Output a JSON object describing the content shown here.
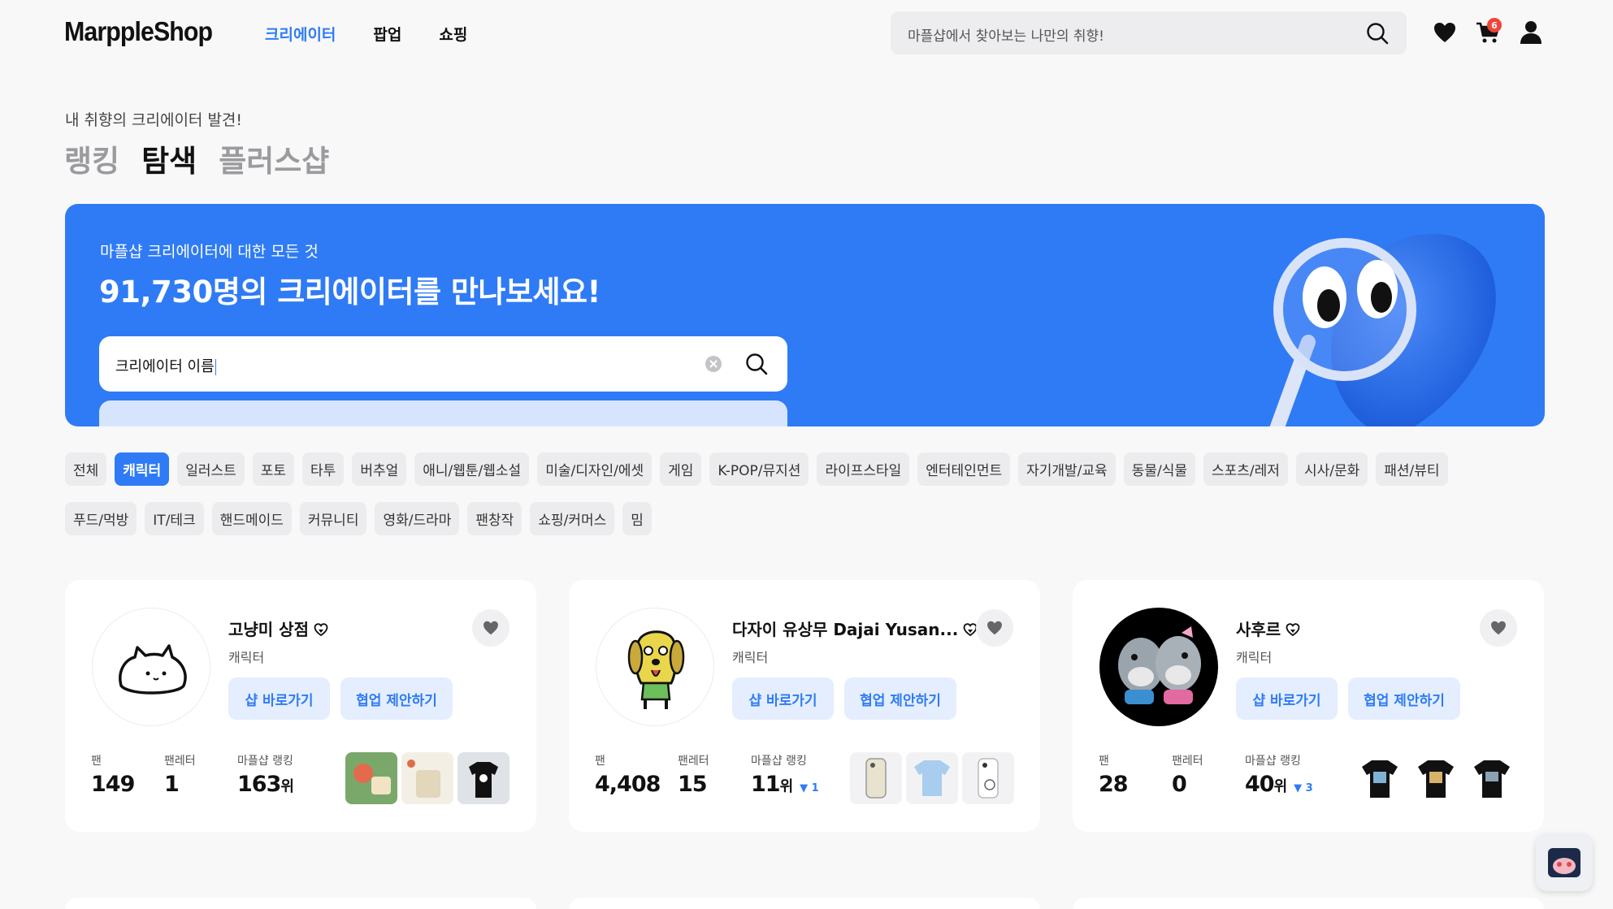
{
  "header": {
    "logo": "MarppleShop",
    "nav": [
      {
        "label": "크리에이터",
        "active": true
      },
      {
        "label": "팝업",
        "active": false
      },
      {
        "label": "쇼핑",
        "active": false
      }
    ],
    "search_placeholder": "마플샵에서 찾아보는 나만의 취향!",
    "cart_count": "6"
  },
  "page": {
    "subtitle": "내 취향의 크리에이터 발견!",
    "tabs": [
      {
        "label": "랭킹",
        "active": false
      },
      {
        "label": "탐색",
        "active": true
      },
      {
        "label": "플러스샵",
        "active": false
      }
    ]
  },
  "banner": {
    "subtitle": "마플샵 크리에이터에 대한 모든 것",
    "title": "91,730명의 크리에이터를 만나보세요!",
    "search_value": "크리에이터 이름"
  },
  "categories": [
    {
      "label": "전체",
      "active": false
    },
    {
      "label": "캐릭터",
      "active": true
    },
    {
      "label": "일러스트",
      "active": false
    },
    {
      "label": "포토",
      "active": false
    },
    {
      "label": "타투",
      "active": false
    },
    {
      "label": "버추얼",
      "active": false
    },
    {
      "label": "애니/웹툰/웹소설",
      "active": false
    },
    {
      "label": "미술/디자인/에셋",
      "active": false
    },
    {
      "label": "게임",
      "active": false
    },
    {
      "label": "K-POP/뮤지션",
      "active": false
    },
    {
      "label": "라이프스타일",
      "active": false
    },
    {
      "label": "엔터테인먼트",
      "active": false
    },
    {
      "label": "자기개발/교육",
      "active": false
    },
    {
      "label": "동물/식물",
      "active": false
    },
    {
      "label": "스포츠/레저",
      "active": false
    },
    {
      "label": "시사/문화",
      "active": false
    },
    {
      "label": "패션/뷰티",
      "active": false
    },
    {
      "label": "푸드/먹방",
      "active": false
    },
    {
      "label": "IT/테크",
      "active": false
    },
    {
      "label": "핸드메이드",
      "active": false
    },
    {
      "label": "커뮤니티",
      "active": false
    },
    {
      "label": "영화/드라마",
      "active": false
    },
    {
      "label": "팬창작",
      "active": false
    },
    {
      "label": "쇼핑/커머스",
      "active": false
    },
    {
      "label": "밈",
      "active": false
    }
  ],
  "card_labels": {
    "shop_button": "샵 바로가기",
    "collab_button": "협업 제안하기",
    "fans": "팬",
    "fan_letters": "팬레터",
    "ranking": "마플샵 랭킹",
    "rank_unit": "위"
  },
  "creators": [
    {
      "name": "고냥미 상점",
      "category": "캐릭터",
      "fans": "149",
      "fan_letters": "1",
      "rank": "163",
      "rank_change": ""
    },
    {
      "name": "다자이 유상무 Dajai Yusan...",
      "category": "캐릭터",
      "fans": "4,408",
      "fan_letters": "15",
      "rank": "11",
      "rank_change": "▼ 1"
    },
    {
      "name": "사후르",
      "category": "캐릭터",
      "fans": "28",
      "fan_letters": "0",
      "rank": "40",
      "rank_change": "▼ 3"
    }
  ],
  "colors": {
    "accent": "#2f7bf5",
    "chip_bg": "#ececee",
    "button_bg": "#e4eefe",
    "badge_red": "#f04438"
  }
}
